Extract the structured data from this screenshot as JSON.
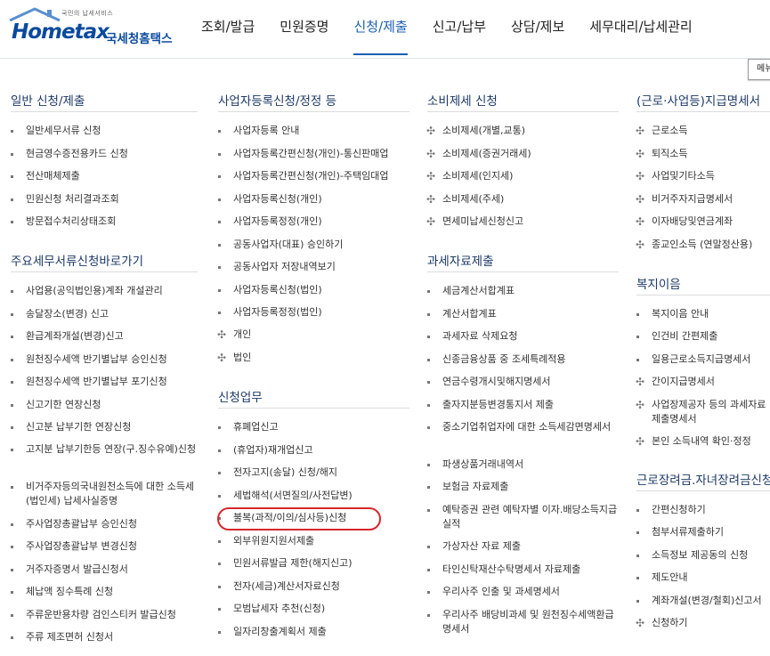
{
  "header": {
    "logo_small": "국민의 납세서비스",
    "logo_brand": "Hometax",
    "logo_kr": "국세청홈택스",
    "nav": [
      "조회/발급",
      "민원증명",
      "신청/제출",
      "신고/납부",
      "상담/제보",
      "세무대리/납세관리"
    ],
    "active_nav": "신청/제출"
  },
  "menu_button": "메뉴",
  "columns": {
    "col1": {
      "sections": [
        {
          "title": "일반 신청/제출",
          "items": [
            "일반세무서류 신청",
            "현금영수증전용카드 신청",
            "전산매체제출",
            "민원신청 처리결과조회",
            "방문접수처리상태조회"
          ]
        },
        {
          "title": "주요세무서류신청바로가기",
          "items": [
            "사업용(공익법인용)계좌 개설관리",
            "송달장소(변경) 신고",
            "환급계좌개설(변경)신고",
            "원천징수세액 반기별납부 승인신청",
            "원천징수세액 반기별납부 포기신청",
            "신고기한 연장신청",
            "신고분 납부기한 연장신청",
            "고지분 납부기한등 연장(구.징수유예)신청",
            "비거주자등의국내원천소득에 대한 소득세(법인세) 납세사실증명",
            "주사업장총괄납부 승인신청",
            "주사업장총괄납부 변경신청",
            "거주자증명서 발급신청서",
            "체납액 징수특례 신청",
            "주류운반용차량 검인스티커 발급신청",
            "주류 제조면허 신청서"
          ]
        }
      ]
    },
    "col2": {
      "sections": [
        {
          "title": "사업자등록신청/정정 등",
          "items": [
            "사업자등록 안내",
            "사업자등록간편신청(개인)-통신판매업",
            "사업자등록간편신청(개인)-주택임대업",
            "사업자등록신청(개인)",
            "사업자등록정정(개인)",
            "공동사업자(대표) 승인하기",
            "공동사업자 저장내역보기",
            "사업자등록신청(법인)",
            "사업자등록정정(법인)"
          ],
          "expand": [
            "개인",
            "법인"
          ]
        },
        {
          "title": "신청업무",
          "items": [
            "휴폐업신고",
            "(휴업자)재개업신고",
            "전자고지(송달) 신청/해지",
            "세법해석(서면질의/사전답변)",
            "불복(과적/이의/심사등)신청",
            "외부위원지원서제출",
            "민원서류발급 제한(해지신고)",
            "전자(세금)계산서자료신청",
            "모범납세자 추천(신청)",
            "일자리창출계획서 제출"
          ]
        }
      ]
    },
    "col3": {
      "sections": [
        {
          "title": "소비제세 신청",
          "expand": [
            "소비제세(개별,교통)",
            "소비제세(증권거래세)",
            "소비제세(인지세)",
            "소비제세(주세)",
            "면세미납세신청신고"
          ]
        },
        {
          "title": "과세자료제출",
          "items": [
            "세금계산서합계표",
            "계산서합계표",
            "과세자료 삭제요청",
            "신종금융상품 중 조세특례적용",
            "연금수령개시및해지명세서",
            "출자지분등변경통지서 제출",
            "중소기업취업자에 대한 소득세감면명세서",
            "파생상품거래내역서",
            "보험금 자료제출",
            "예탁증권 관련 예탁자별 이자.배당소득지급 실적",
            "가상자산 자료 제출",
            "타인신탁재산수탁명세서 자료제출",
            "우리사주 인출 및 과세명세서",
            "우리사주 배당비과세 및 원천징수세액환급명세서"
          ]
        }
      ]
    },
    "col4": {
      "sections": [
        {
          "title": "(근로·사업등)지급명세서",
          "expand": [
            "근로소득",
            "퇴직소득",
            "사업및기타소득",
            "비거주자지급명세서",
            "이자배당및연금계좌",
            "종교인소득 (연말정산용)"
          ]
        },
        {
          "title": "복지이음",
          "items": [
            "복지이음 안내",
            "인건비 간편제출",
            "일용근로소득지급명세서"
          ],
          "expand": [
            "간이지급명세서",
            "사업장제공자 등의 과세자료제출명세서",
            "본인 소득내역 확인·정정"
          ]
        },
        {
          "title": "근로장려금.자녀장려금신청",
          "items": [
            "간편신청하기",
            "첨부서류제출하기",
            "소득정보 제공동의 신청",
            "제도안내",
            "계좌개설(변경/철회)신고서"
          ],
          "expand": [
            "신청하기"
          ]
        }
      ]
    }
  }
}
